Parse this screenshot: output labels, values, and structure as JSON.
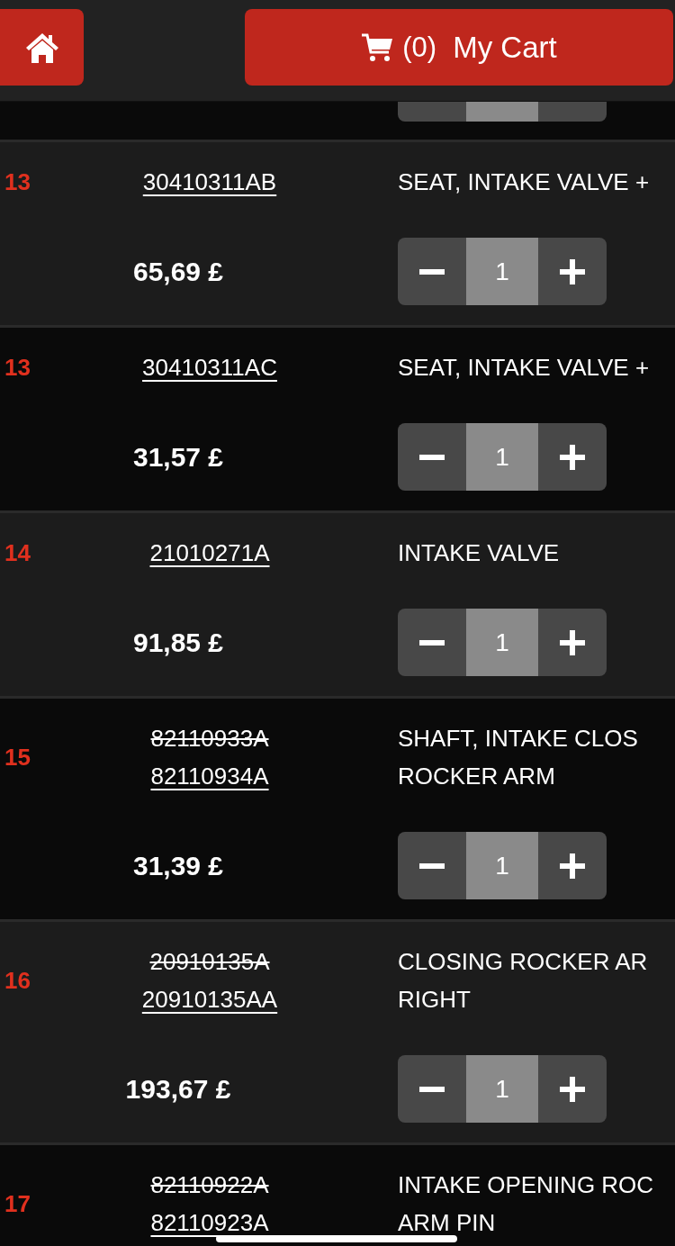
{
  "header": {
    "cart": {
      "count": "(0)",
      "label": "My Cart"
    }
  },
  "rows": [
    {
      "index": "13",
      "parts": [
        {
          "number": "30410311AB",
          "superseded": false
        }
      ],
      "description": [
        "SEAT, INTAKE VALVE +"
      ],
      "price": "65,69 £",
      "quantity": "1"
    },
    {
      "index": "13",
      "parts": [
        {
          "number": "30410311AC",
          "superseded": false
        }
      ],
      "description": [
        "SEAT, INTAKE VALVE +"
      ],
      "price": "31,57 £",
      "quantity": "1"
    },
    {
      "index": "14",
      "parts": [
        {
          "number": "21010271A",
          "superseded": false
        }
      ],
      "description": [
        "INTAKE VALVE"
      ],
      "price": "91,85 £",
      "quantity": "1"
    },
    {
      "index": "15",
      "parts": [
        {
          "number": "82110933A",
          "superseded": true
        },
        {
          "number": "82110934A",
          "superseded": false
        }
      ],
      "description": [
        "SHAFT, INTAKE CLOS",
        "ROCKER ARM"
      ],
      "price": "31,39 £",
      "quantity": "1"
    },
    {
      "index": "16",
      "parts": [
        {
          "number": "20910135A",
          "superseded": true
        },
        {
          "number": "20910135AA",
          "superseded": false
        }
      ],
      "description": [
        "CLOSING ROCKER AR",
        "RIGHT"
      ],
      "price": "193,67 £",
      "quantity": "1"
    },
    {
      "index": "17",
      "parts": [
        {
          "number": "82110922A",
          "superseded": true
        },
        {
          "number": "82110923A",
          "superseded": false
        }
      ],
      "description": [
        "INTAKE OPENING ROC",
        "ARM PIN"
      ]
    }
  ]
}
